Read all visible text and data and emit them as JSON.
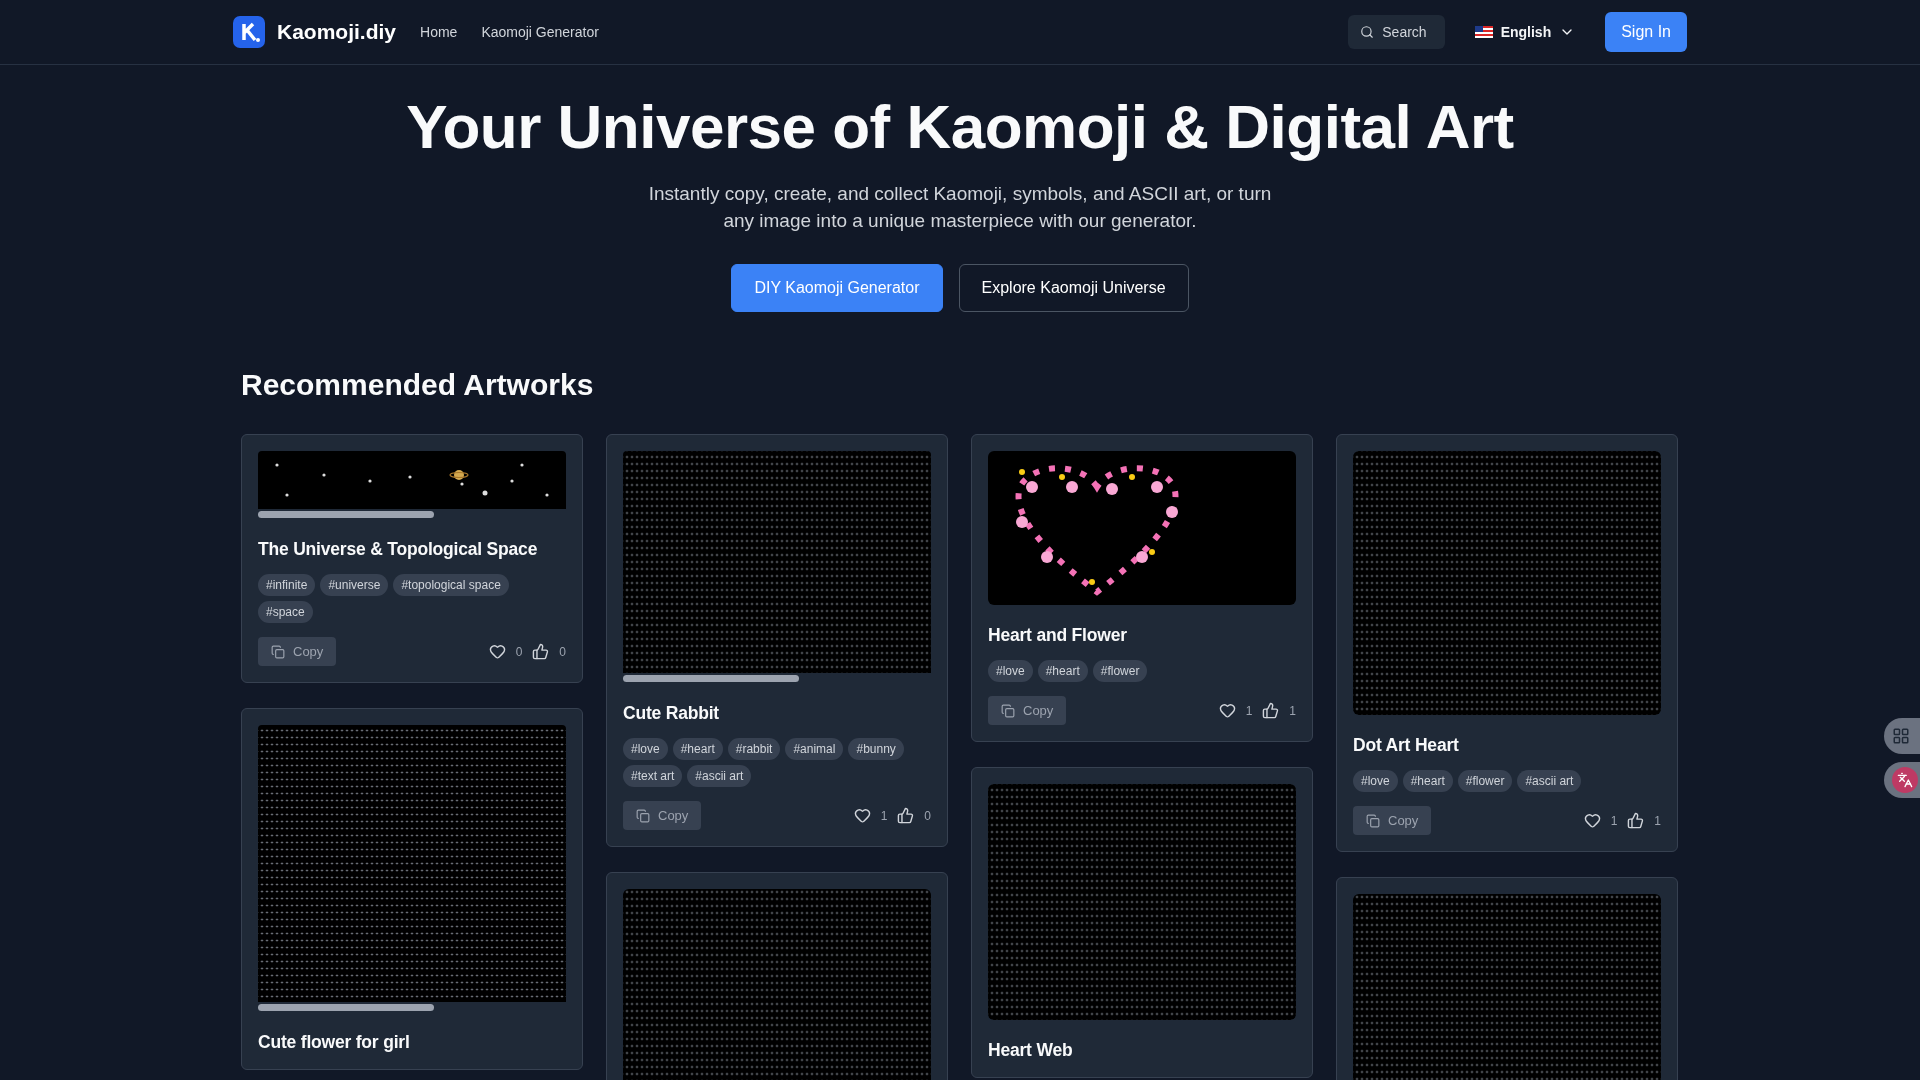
{
  "header": {
    "brand": "Kaomoji.diy",
    "nav": [
      {
        "label": "Home"
      },
      {
        "label": "Kaomoji Generator"
      }
    ],
    "search": "Search",
    "language": "English",
    "sign_in": "Sign In"
  },
  "hero": {
    "title": "Your Universe of Kaomoji & Digital Art",
    "subtitle": "Instantly copy, create, and collect Kaomoji, symbols, and ASCII art, or turn any image into a unique masterpiece with our generator.",
    "primary": "DIY Kaomoji Generator",
    "secondary": "Explore Kaomoji Universe"
  },
  "section_title": "Recommended Artworks",
  "artworks": [
    {
      "kind": "stars",
      "scroll": true,
      "title": "The Universe & Topological Space",
      "tags": [
        "#infinite",
        "#universe",
        "#topological space",
        "#space"
      ],
      "copy": "Copy",
      "likes": "0",
      "thumbs": "0"
    },
    {
      "kind": "dots",
      "scroll": true,
      "title": "Cute Rabbit",
      "tags": [
        "#love",
        "#heart",
        "#rabbit",
        "#animal",
        "#bunny",
        "#text art",
        "#ascii art"
      ],
      "copy": "Copy",
      "likes": "1",
      "thumbs": "0"
    },
    {
      "kind": "emoji",
      "scroll": false,
      "title": "Heart and Flower",
      "tags": [
        "#love",
        "#heart",
        "#flower"
      ],
      "copy": "Copy",
      "likes": "1",
      "thumbs": "1"
    },
    {
      "kind": "dots",
      "scroll": false,
      "title": "Dot Art Heart",
      "tags": [
        "#love",
        "#heart",
        "#flower",
        "#ascii art"
      ],
      "copy": "Copy",
      "likes": "1",
      "thumbs": "1"
    },
    {
      "kind": "dots",
      "scroll": true,
      "title": "Cute flower for girl"
    },
    {
      "kind": "dots",
      "scroll": false
    },
    {
      "kind": "dots",
      "scroll": false,
      "title": "Heart Web"
    },
    {
      "kind": "dots",
      "scroll": false
    }
  ]
}
